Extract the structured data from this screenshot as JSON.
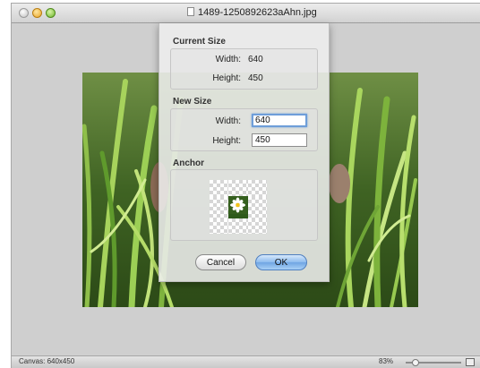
{
  "window": {
    "title": "1489-1250892623aAhn.jpg"
  },
  "canvas": {
    "image": "grass-photo-with-rabbit"
  },
  "dialog": {
    "current_size": {
      "title": "Current Size",
      "width_label": "Width:",
      "width_value": "640",
      "height_label": "Height:",
      "height_value": "450"
    },
    "new_size": {
      "title": "New Size",
      "width_label": "Width:",
      "width_value": "640",
      "height_label": "Height:",
      "height_value": "450"
    },
    "anchor": {
      "title": "Anchor",
      "selected": "center"
    },
    "cancel_label": "Cancel",
    "ok_label": "OK"
  },
  "statusbar": {
    "canvas_text": "Canvas: 640x450",
    "zoom_text": "83%"
  },
  "colors": {
    "focus_ring": "#6e9ed9",
    "ok_button": "#6fa5e3",
    "window_bg": "#cfcfcf"
  }
}
